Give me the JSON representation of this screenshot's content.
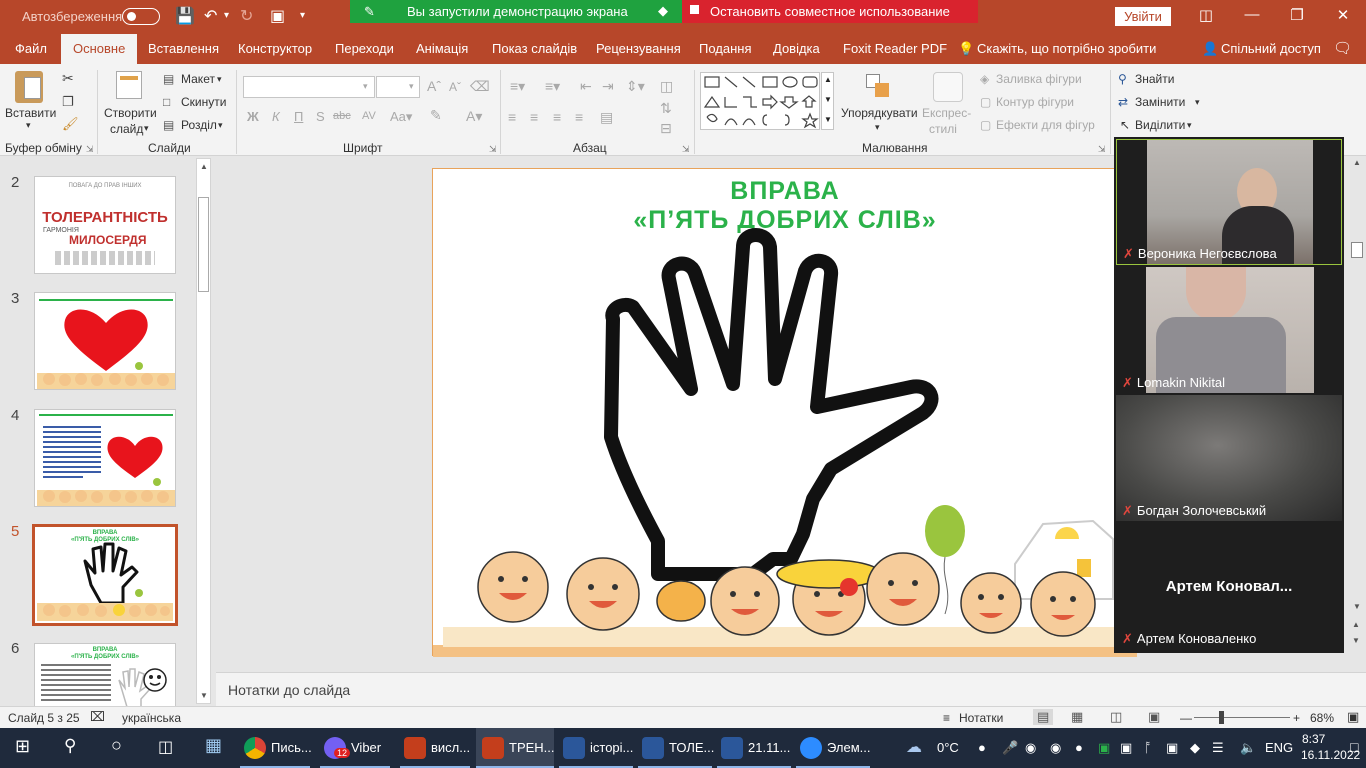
{
  "titlebar": {
    "autosave_label": "Автозбереження",
    "share_notice": "Вы запустили демонстрацию экрана",
    "stop_share": "Остановить совместное использование",
    "signin": "Увійти"
  },
  "tabs": [
    "Файл",
    "Основне",
    "Вставлення",
    "Конструктор",
    "Переходи",
    "Анімація",
    "Показ слайдів",
    "Рецензування",
    "Подання",
    "Довідка",
    "Foxit Reader PDF",
    "Скажіть, що потрібно зробити",
    "Спільний доступ"
  ],
  "ribbon": {
    "paste": "Вставити",
    "clipboard_group": "Буфер обміну",
    "new_slide_1": "Створити",
    "new_slide_2": "слайд",
    "layout": "Макет",
    "reset": "Скинути",
    "section": "Розділ",
    "slides_group": "Слайди",
    "bold": "Ж",
    "italic": "К",
    "underline": "П",
    "shadow": "S",
    "strike": "abc",
    "spacing": "AV",
    "font_group": "Шрифт",
    "paragraph_group": "Абзац",
    "arrange": "Упорядкувати",
    "quick_styles_1": "Експрес-",
    "quick_styles_2": "стилі",
    "shape_fill": "Заливка фігури",
    "shape_outline": "Контур фігури",
    "shape_effects": "Ефекти для фігур",
    "drawing_group": "Малювання",
    "find": "Знайти",
    "replace": "Замінити",
    "select": "Виділити"
  },
  "thumbnails": [
    {
      "num": "2"
    },
    {
      "num": "3"
    },
    {
      "num": "4"
    },
    {
      "num": "5"
    },
    {
      "num": "6"
    }
  ],
  "thumb_text": {
    "s2_main": "ТОЛЕРАНТНІСТЬ",
    "s2_sub": "МИЛОСЕРДЯ",
    "s2_a": "ПОВАГА ДО ПРАВ ІНШИХ",
    "s2_b": "ГАРМОНІЯ",
    "s5_t1": "ВПРАВА",
    "s5_t2": "«П'ЯТЬ ДОБРИХ СЛІВ»",
    "s6_t1": "ВПРАВА",
    "s6_t2": "«П'ЯТЬ ДОБРИХ СЛІВ»"
  },
  "slide": {
    "title1": "ВПРАВА",
    "title2": "«П’ЯТЬ ДОБРИХ СЛІВ»"
  },
  "notes": "Нотатки до слайда",
  "zoom": {
    "participants": [
      {
        "name": "Вероника Негоєвслова"
      },
      {
        "name": "Lomakin Nikital"
      },
      {
        "name": "Богдан Золочевський"
      },
      {
        "name": "Артем Коноваленко"
      }
    ],
    "big_name": "Артем Коновал..."
  },
  "status": {
    "slide_info": "Слайд 5 з 25",
    "language": "українська",
    "notes_btn": "Нотатки",
    "zoom_level": "68%"
  },
  "taskbar": {
    "apps": [
      "Пись...",
      "Viber",
      "висл...",
      "ТРЕН...",
      "історі...",
      "ТОЛЕ...",
      "21.11...",
      "Элем..."
    ],
    "viber_badge": "12",
    "weather": "0°C",
    "lang": "ENG",
    "time": "8:37",
    "date": "16.11.2022"
  },
  "colors": {
    "accent": "#b7472a",
    "slide_title": "#2bb24a",
    "zoom_bg": "#1e1e1e",
    "taskbar": "#1f2a3c"
  }
}
